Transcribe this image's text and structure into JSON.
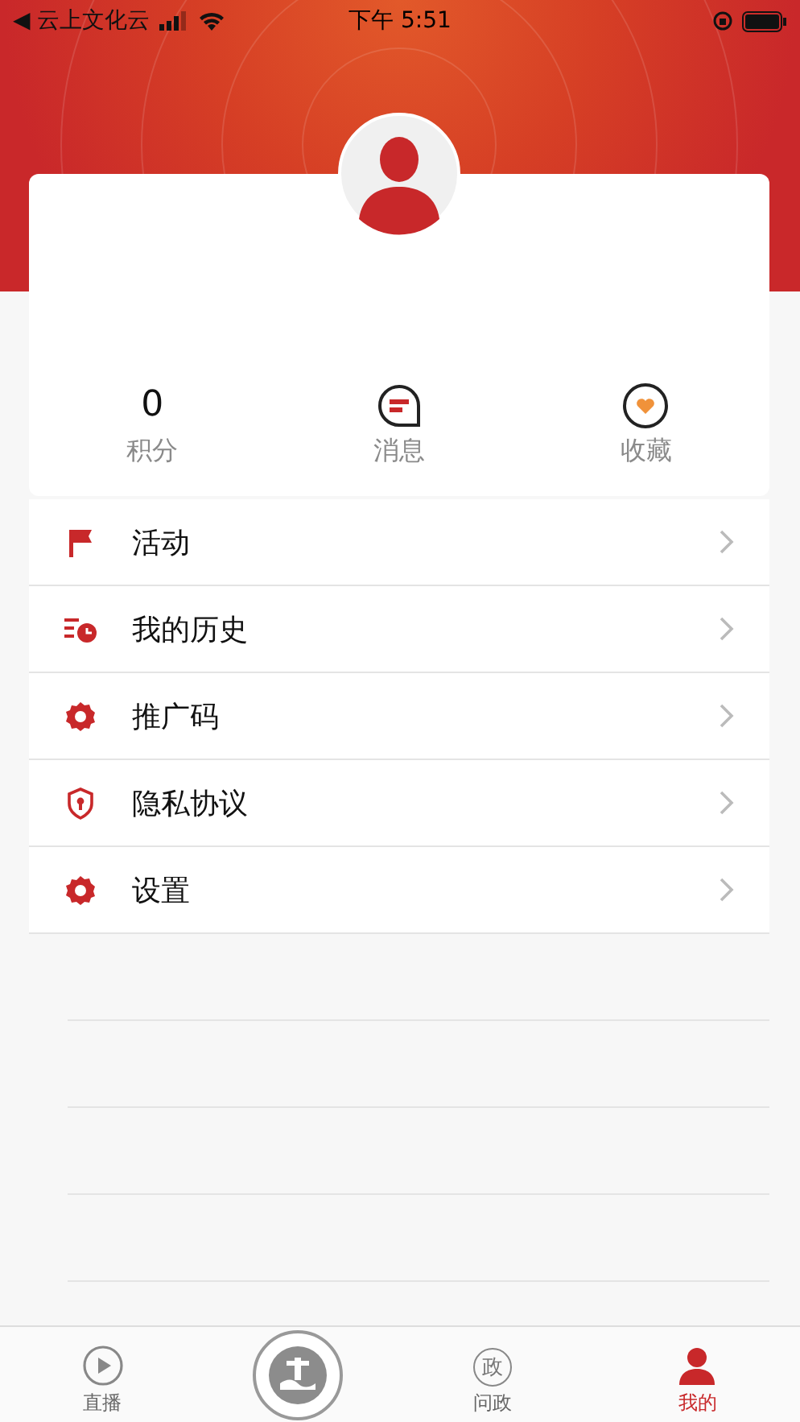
{
  "status_bar": {
    "back_app": "◀ 云上文化云",
    "time": "下午 5:51"
  },
  "stats": [
    {
      "kind": "value",
      "value": "0",
      "label": "积分"
    },
    {
      "kind": "message",
      "label": "消息"
    },
    {
      "kind": "favorite",
      "label": "收藏"
    }
  ],
  "menu": [
    {
      "kind": "flag",
      "label": "活动"
    },
    {
      "kind": "history",
      "label": "我的历史"
    },
    {
      "kind": "gear",
      "label": "推广码"
    },
    {
      "kind": "shield",
      "label": "隐私协议"
    },
    {
      "kind": "gear",
      "label": "设置"
    }
  ],
  "tabs": [
    {
      "kind": "play",
      "label": "直播",
      "selected": false
    },
    {
      "kind": "center",
      "selected": false
    },
    {
      "kind": "politics",
      "icon_char": "政",
      "label": "问政",
      "selected": false
    },
    {
      "kind": "person",
      "label": "我的",
      "selected": true
    }
  ]
}
